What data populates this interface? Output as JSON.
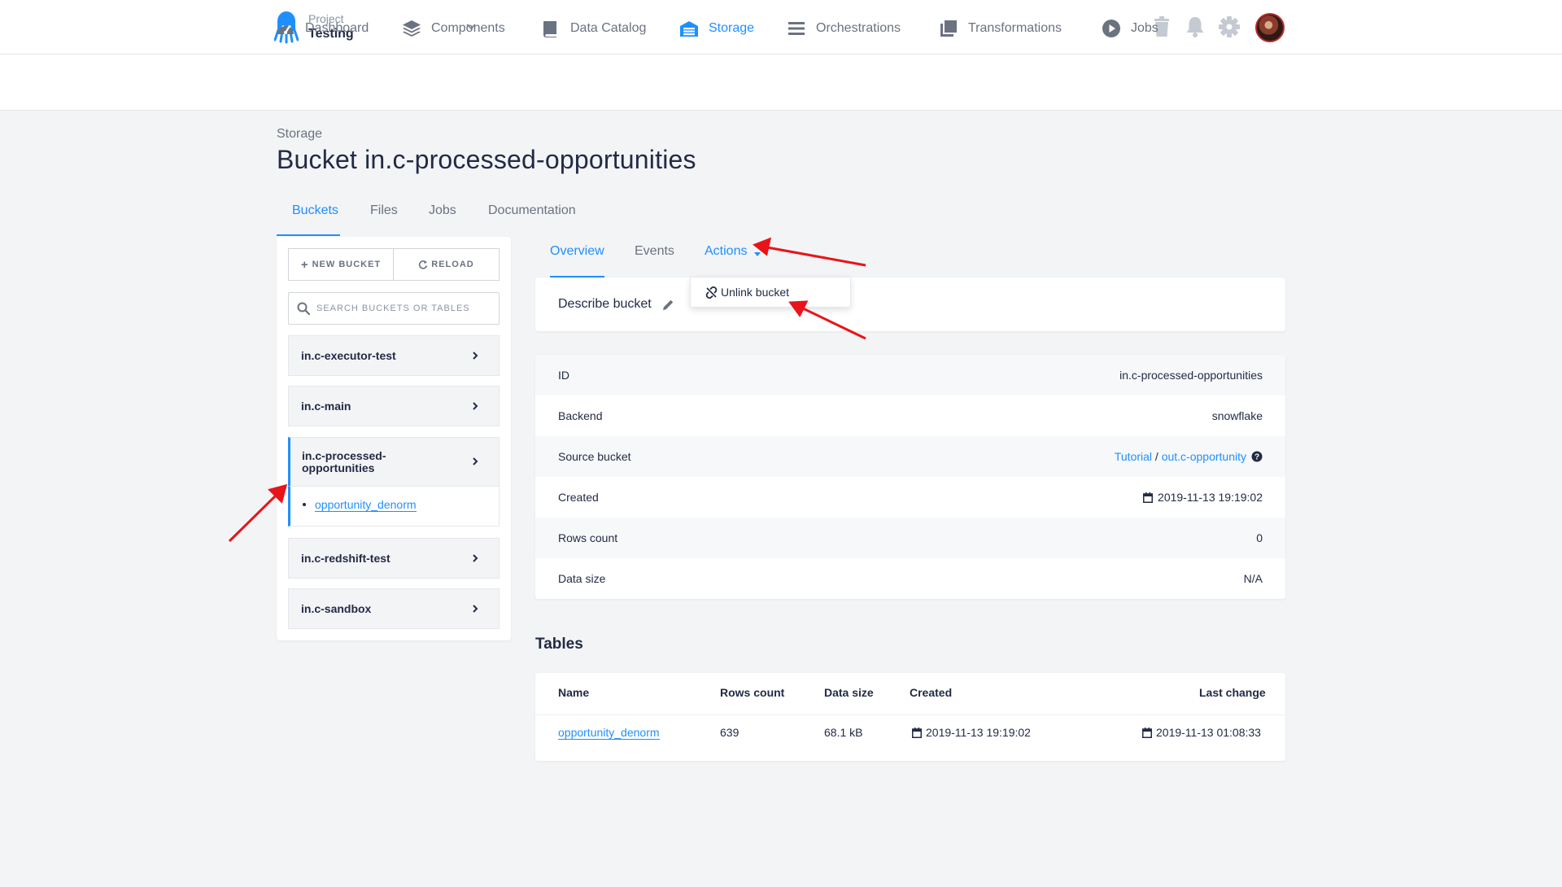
{
  "project": {
    "label": "Project",
    "name": "Testing"
  },
  "topbar_icons": [
    "trash-icon",
    "bell-icon",
    "gear-icon",
    "avatar"
  ],
  "nav": [
    {
      "label": "Dashboard",
      "icon": "speedometer-icon",
      "active": false
    },
    {
      "label": "Components",
      "icon": "layers-icon",
      "active": false
    },
    {
      "label": "Data Catalog",
      "icon": "book-icon",
      "active": false
    },
    {
      "label": "Storage",
      "icon": "warehouse-icon",
      "active": true
    },
    {
      "label": "Orchestrations",
      "icon": "bars-icon",
      "active": false
    },
    {
      "label": "Transformations",
      "icon": "copy-icon",
      "active": false
    },
    {
      "label": "Jobs",
      "icon": "play-icon",
      "active": false
    }
  ],
  "breadcrumb": "Storage",
  "page_title": "Bucket in.c-processed-opportunities",
  "subtabs": [
    "Buckets",
    "Files",
    "Jobs",
    "Documentation"
  ],
  "sidebar": {
    "new_bucket": "NEW BUCKET",
    "reload": "RELOAD",
    "search_placeholder": "SEARCH BUCKETS OR TABLES",
    "buckets": [
      {
        "name": "in.c-executor-test"
      },
      {
        "name": "in.c-main"
      },
      {
        "name": "in.c-processed-\nopportunities",
        "selected": true,
        "tables": [
          "opportunity_denorm"
        ]
      },
      {
        "name": "in.c-redshift-test"
      },
      {
        "name": "in.c-sandbox"
      }
    ]
  },
  "detail_tabs": [
    "Overview",
    "Events",
    "Actions"
  ],
  "describe": "Describe bucket",
  "actions_menu": {
    "item": "Unlink bucket"
  },
  "info": {
    "id_label": "ID",
    "id_value": "in.c-processed-opportunities",
    "backend_label": "Backend",
    "backend_value": "snowflake",
    "source_label": "Source bucket",
    "source_project": "Tutorial",
    "source_sep": " / ",
    "source_bucket": "out.c-opportunity",
    "created_label": "Created",
    "created_value": "2019-11-13 19:19:02",
    "rows_label": "Rows count",
    "rows_value": "0",
    "size_label": "Data size",
    "size_value": "N/A"
  },
  "tables": {
    "heading": "Tables",
    "columns": [
      "Name",
      "Rows count",
      "Data size",
      "Created",
      "Last change"
    ],
    "rows": [
      {
        "name": "opportunity_denorm",
        "rows": "639",
        "size": "68.1 kB",
        "created": "2019-11-13 19:19:02",
        "last_change": "2019-11-13 01:08:33"
      }
    ]
  },
  "colors": {
    "accent": "#1f8fff",
    "annotation_arrow": "#e8141a"
  }
}
